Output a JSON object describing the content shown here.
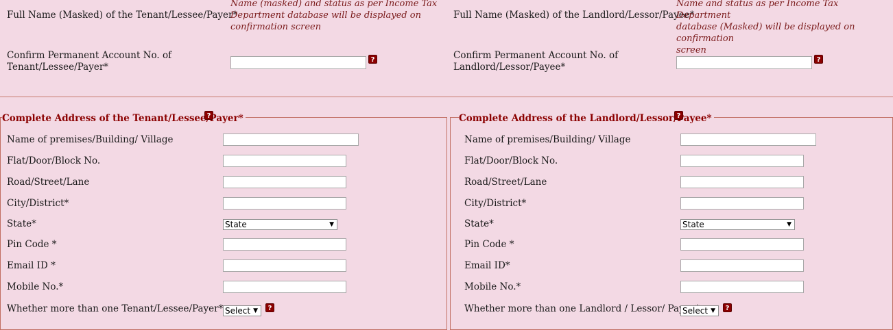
{
  "top": {
    "tenant_name_label": "Full Name (Masked) of the Tenant/Lessee/Payer*",
    "tenant_name_note": [
      "Name (masked) and status as per Income Tax",
      "Department database will be displayed on",
      "confirmation screen"
    ],
    "landlord_name_label": "Full Name (Masked) of the Landlord/Lessor/Payee*",
    "landlord_name_note": [
      "Name and status as per Income Tax Department",
      "database (Masked) will be displayed on confirmation",
      "screen"
    ],
    "tenant_pan_label": [
      "Confirm Permanent Account No. of",
      "Tenant/Lessee/Payer*"
    ],
    "tenant_pan_value": "",
    "landlord_pan_label": [
      "Confirm Permanent Account No. of",
      "Landlord/Lessor/Payee*"
    ],
    "landlord_pan_value": ""
  },
  "help_icon": "?",
  "tenant": {
    "legend": "Complete Address of the Tenant/Lessee/Payer*",
    "fields": {
      "premises": "Name of premises/Building/ Village",
      "flat": "Flat/Door/Block No.",
      "road": "Road/Street/Lane",
      "city": "City/District*",
      "state": "State*",
      "pin": "Pin Code *",
      "email": "Email ID *",
      "mobile": "Mobile No.*",
      "more": "Whether more than one Tenant/Lessee/Payer*"
    },
    "state_value": "State",
    "more_value": "Select"
  },
  "landlord": {
    "legend": "Complete Address of the Landlord/Lessor/Payee*",
    "fields": {
      "premises": "Name of premises/Building/ Village",
      "flat": "Flat/Door/Block No.",
      "road": "Road/Street/Lane",
      "city": "City/District*",
      "state": "State*",
      "pin": "Pin Code *",
      "email": "Email ID*",
      "mobile": "Mobile No.*",
      "more": "Whether more than one Landlord / Lessor/ Payee*"
    },
    "state_value": "State",
    "more_value": "Select"
  },
  "icons": {
    "help": "help-icon",
    "dropdown": "chevron-down-icon"
  },
  "colors": {
    "background": "#f3d9e4",
    "legend": "#8b0000",
    "note": "#7a1a1a",
    "border": "#c06c60"
  }
}
